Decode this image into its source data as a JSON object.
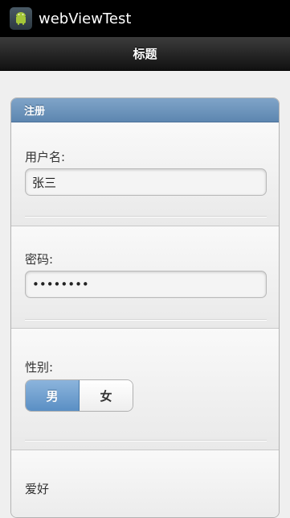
{
  "app": {
    "title": "webViewTest"
  },
  "header": {
    "title": "标题"
  },
  "form": {
    "panel_title": "注册",
    "username": {
      "label": "用户名:",
      "value": "张三"
    },
    "password": {
      "label": "密码:",
      "value": "••••••••"
    },
    "gender": {
      "label": "性别:",
      "options": [
        "男",
        "女"
      ],
      "selected": "男"
    },
    "hobbies": {
      "label": "爱好"
    }
  },
  "colors": {
    "accent": "#5d86b0",
    "selected": "#5a8fc4"
  }
}
